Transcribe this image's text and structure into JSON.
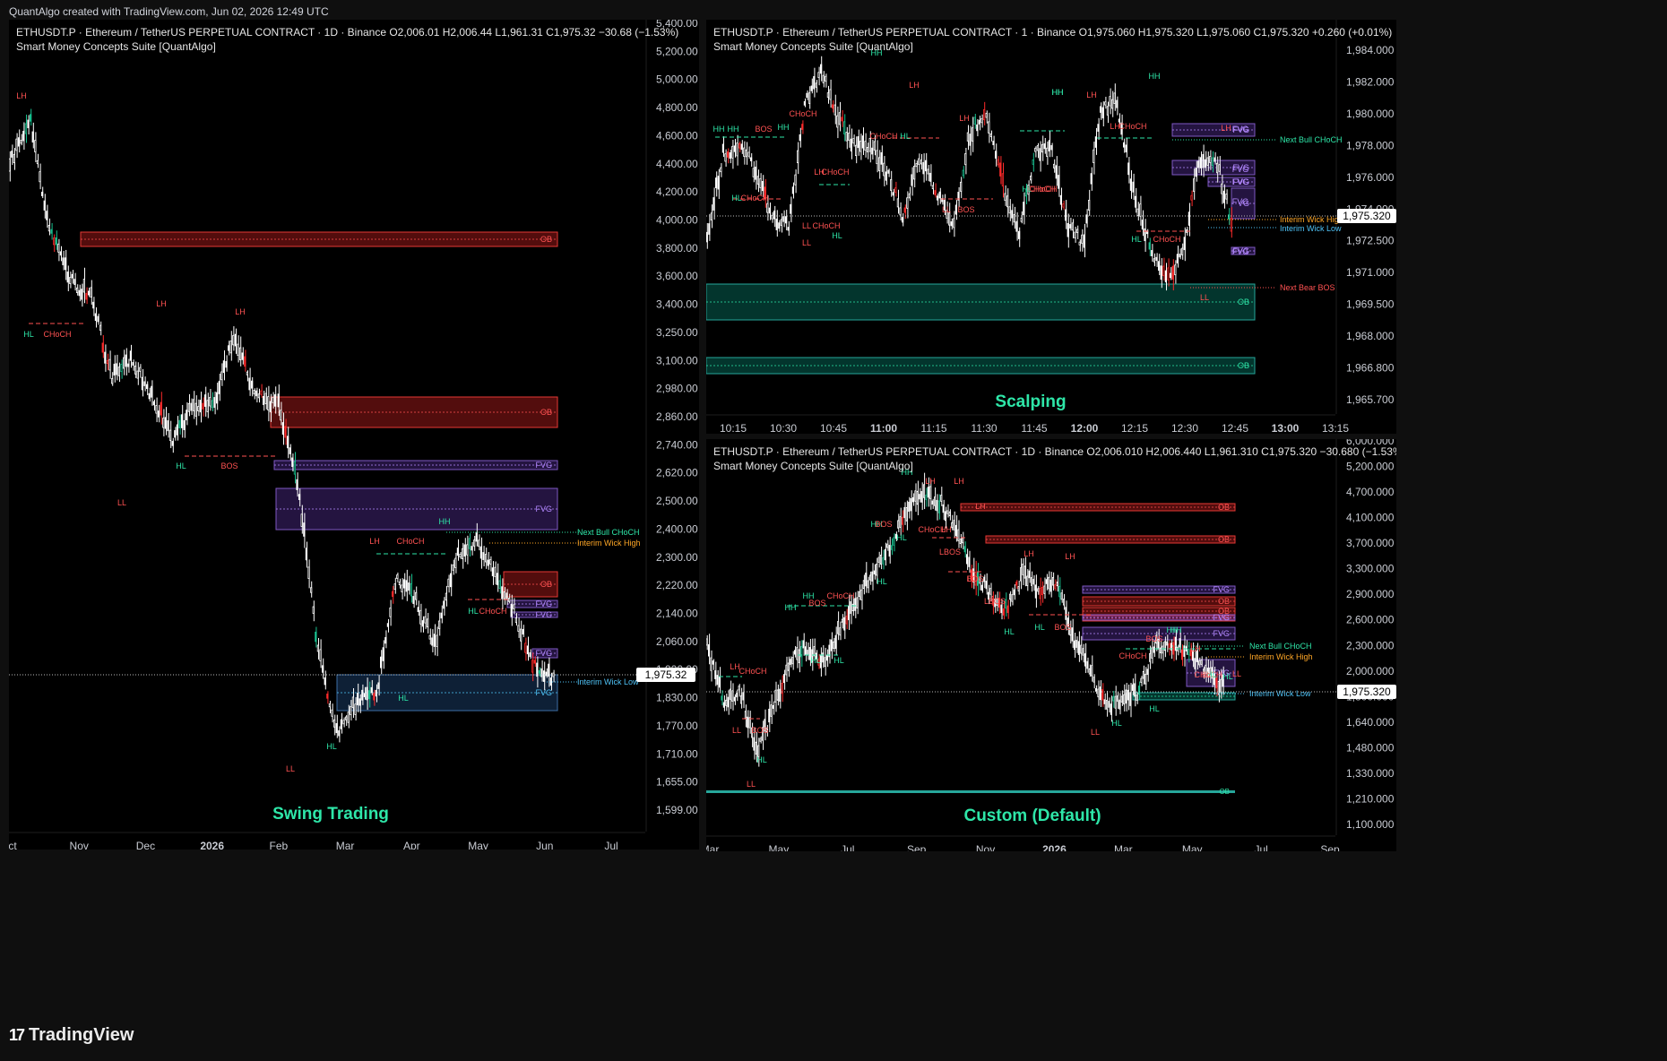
{
  "topline": "QuantAlgo created with TradingView.com, Jun 02, 2026 12:49 UTC",
  "footer": {
    "logo": "17",
    "brand": "TradingView"
  },
  "colors": {
    "bg": "#000000",
    "bull": "#26a69a",
    "bear": "#ef5350",
    "green_zone": "#089981",
    "red_zone": "#b71c1c",
    "fvg": "#7e57c2",
    "blue_zone": "#1e3a5f",
    "label_green": "#2ee6a8"
  },
  "panels": {
    "swing": {
      "title": "ETHUSDT.P · Ethereum / TetherUS PERPETUAL CONTRACT · 1D · Binance  O2,006.01  H2,006.44  L1,961.31  C1,975.32  −30.68 (−1.53%)",
      "subtitle": "Smart Money Concepts Suite [QuantAlgo]",
      "watermark": "Swing Trading",
      "price_label": "1,975.32",
      "y_ticks": [
        "5,400.00",
        "5,200.00",
        "5,000.00",
        "4,800.00",
        "4,600.00",
        "4,400.00",
        "4,200.00",
        "4,000.00",
        "3,800.00",
        "3,600.00",
        "3,400.00",
        "3,250.00",
        "3,100.00",
        "2,980.00",
        "2,860.00",
        "2,740.00",
        "2,620.00",
        "2,500.00",
        "2,400.00",
        "2,300.00",
        "2,220.00",
        "2,140.00",
        "2,060.00",
        "1,900.00",
        "1,830.00",
        "1,770.00",
        "1,710.00",
        "1,655.00",
        "1,599.00"
      ],
      "x_ticks": [
        "ct",
        "Nov",
        "Dec",
        "2026",
        "Feb",
        "Mar",
        "Apr",
        "May",
        "Jun",
        "Jul"
      ],
      "labels": [
        "LH",
        "HL",
        "CHoCH",
        "LH",
        "LH",
        "HL",
        "BOS",
        "LL",
        "HH",
        "LH",
        "CHoCH",
        "HL",
        "CHoCH",
        "HL",
        "HL",
        "LL",
        "OB",
        "OB",
        "FVG",
        "FVG",
        "OB",
        "FVG",
        "FVG",
        "FVG",
        "FVG",
        "Next Bull CHoCH",
        "Interim Wick High",
        "Interim Wick Low"
      ]
    },
    "scalp": {
      "title": "ETHUSDT.P · Ethereum / TetherUS PERPETUAL CONTRACT · 1 · Binance  O1,975.060  H1,975.320  L1,975.060  C1,975.320  +0.260 (+0.01%)",
      "subtitle": "Smart Money Concepts Suite [QuantAlgo]",
      "watermark": "Scalping",
      "price_label": "1,975.320",
      "y_ticks": [
        "1,984.000",
        "1,982.000",
        "1,980.000",
        "1,978.000",
        "1,976.000",
        "1,974.000",
        "1,972.500",
        "1,971.000",
        "1,969.500",
        "1,968.000",
        "1,966.800",
        "1,965.700"
      ],
      "x_ticks": [
        "10:15",
        "10:30",
        "10:45",
        "11:00",
        "11:15",
        "11:30",
        "11:45",
        "12:00",
        "12:15",
        "12:30",
        "12:45",
        "13:00",
        "13:15"
      ],
      "labels": [
        "HH",
        "HH",
        "BOS",
        "HH",
        "CHoCH",
        "HH",
        "HL",
        "CHoCH",
        "LL",
        "CHoCH",
        "LH",
        "CHoCH",
        "HL",
        "LH",
        "HL",
        "CHoCH",
        "LL",
        "BOS",
        "LL",
        "LH",
        "CHoCH",
        "HH",
        "HL",
        "CHoCH",
        "HH",
        "LH",
        "LH",
        "CHoCH",
        "HL",
        "CHoCH",
        "HH",
        "LH",
        "LL",
        "FVG",
        "FVG",
        "FVG",
        "FVG",
        "VG",
        "FVG",
        "OB",
        "OB",
        "Next Bull CHoCH",
        "Interim Wick High",
        "Interim Wick Low",
        "Next Bear BOS"
      ]
    },
    "custom": {
      "title": "ETHUSDT.P · Ethereum / TetherUS PERPETUAL CONTRACT · 1D · Binance  O2,006.010  H2,006.440  L1,961.310  C1,975.320  −30.680 (−1.53%)",
      "subtitle": "Smart Money Concepts Suite [QuantAlgo]",
      "watermark": "Custom (Default)",
      "price_label": "1,975.320",
      "y_ticks": [
        "6,000.000",
        "5,200.000",
        "4,700.000",
        "4,100.000",
        "3,700.000",
        "3,300.000",
        "2,900.000",
        "2,600.000",
        "2,300.000",
        "2,000.000",
        "1,800.000",
        "1,640.000",
        "1,480.000",
        "1,330.000",
        "1,210.000",
        "1,100.000"
      ],
      "x_ticks": [
        "Mar",
        "May",
        "Jul",
        "Sep",
        "Nov",
        "2026",
        "Mar",
        "May",
        "Jul",
        "Sep"
      ],
      "labels": [
        "HH",
        "LH",
        "LH",
        "HH",
        "BOS",
        "HL",
        "LH",
        "CHoCH",
        "LH",
        "HH",
        "BOS",
        "HH",
        "CHoCH",
        "HL",
        "HL",
        "HL",
        "LH",
        "CHoCH",
        "LL",
        "BOS",
        "HL",
        "LL",
        "LBOS",
        "LL",
        "BOS",
        "LBOS",
        "LH",
        "LH",
        "HL",
        "HL",
        "BOS",
        "LL",
        "HL",
        "HH",
        "BOS",
        "CHoCH",
        "HH",
        "HL",
        "LH",
        "CHoCH",
        "HL",
        "LL",
        "HL",
        "LL",
        "OB",
        "OB",
        "OB",
        "OB",
        "OB",
        "FVG",
        "FVG",
        "FVG",
        "FVG",
        "Next Bull CHoCH",
        "Interim Wick High",
        "Interim Wick Low"
      ]
    }
  }
}
